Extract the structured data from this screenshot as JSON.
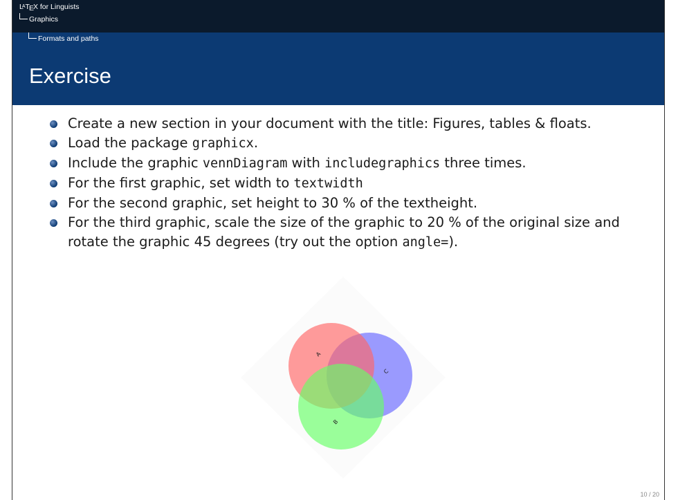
{
  "header": {
    "crumb_title_pre": "L",
    "crumb_title_a": "A",
    "crumb_title_t": "T",
    "crumb_title_e": "E",
    "crumb_title_x": "X",
    "crumb_title_rest": " for Linguists",
    "crumb_section": "Graphics",
    "crumb_subsection": "Formats and paths"
  },
  "frame": {
    "title": "Exercise"
  },
  "items": [
    {
      "text": "Create a new section in your document with the title: Figures, tables & floats."
    },
    {
      "pre": "Load the package ",
      "code": "graphicx",
      "post": "."
    },
    {
      "pre": "Include the graphic ",
      "code1": "vennDiagram",
      "mid": " with ",
      "code2": "includegraphics",
      "post": " three times."
    },
    {
      "pre": "For the first graphic, set width to ",
      "code": "textwidth"
    },
    {
      "text": "For the second graphic, set height to 30 % of the textheight."
    },
    {
      "pre": "For the third graphic, scale the size of the graphic to 20 % of the original size and rotate the graphic 45 degrees (try out the option ",
      "code": "angle=",
      "post": ")."
    }
  ],
  "venn": {
    "label_a": "A",
    "label_b": "B",
    "label_c": "C",
    "color_a": "#ff6666",
    "color_b": "#66ff66",
    "color_c": "#6666ff",
    "bg": "#fbfbfb"
  },
  "footer": {
    "page": "10 / 20"
  }
}
